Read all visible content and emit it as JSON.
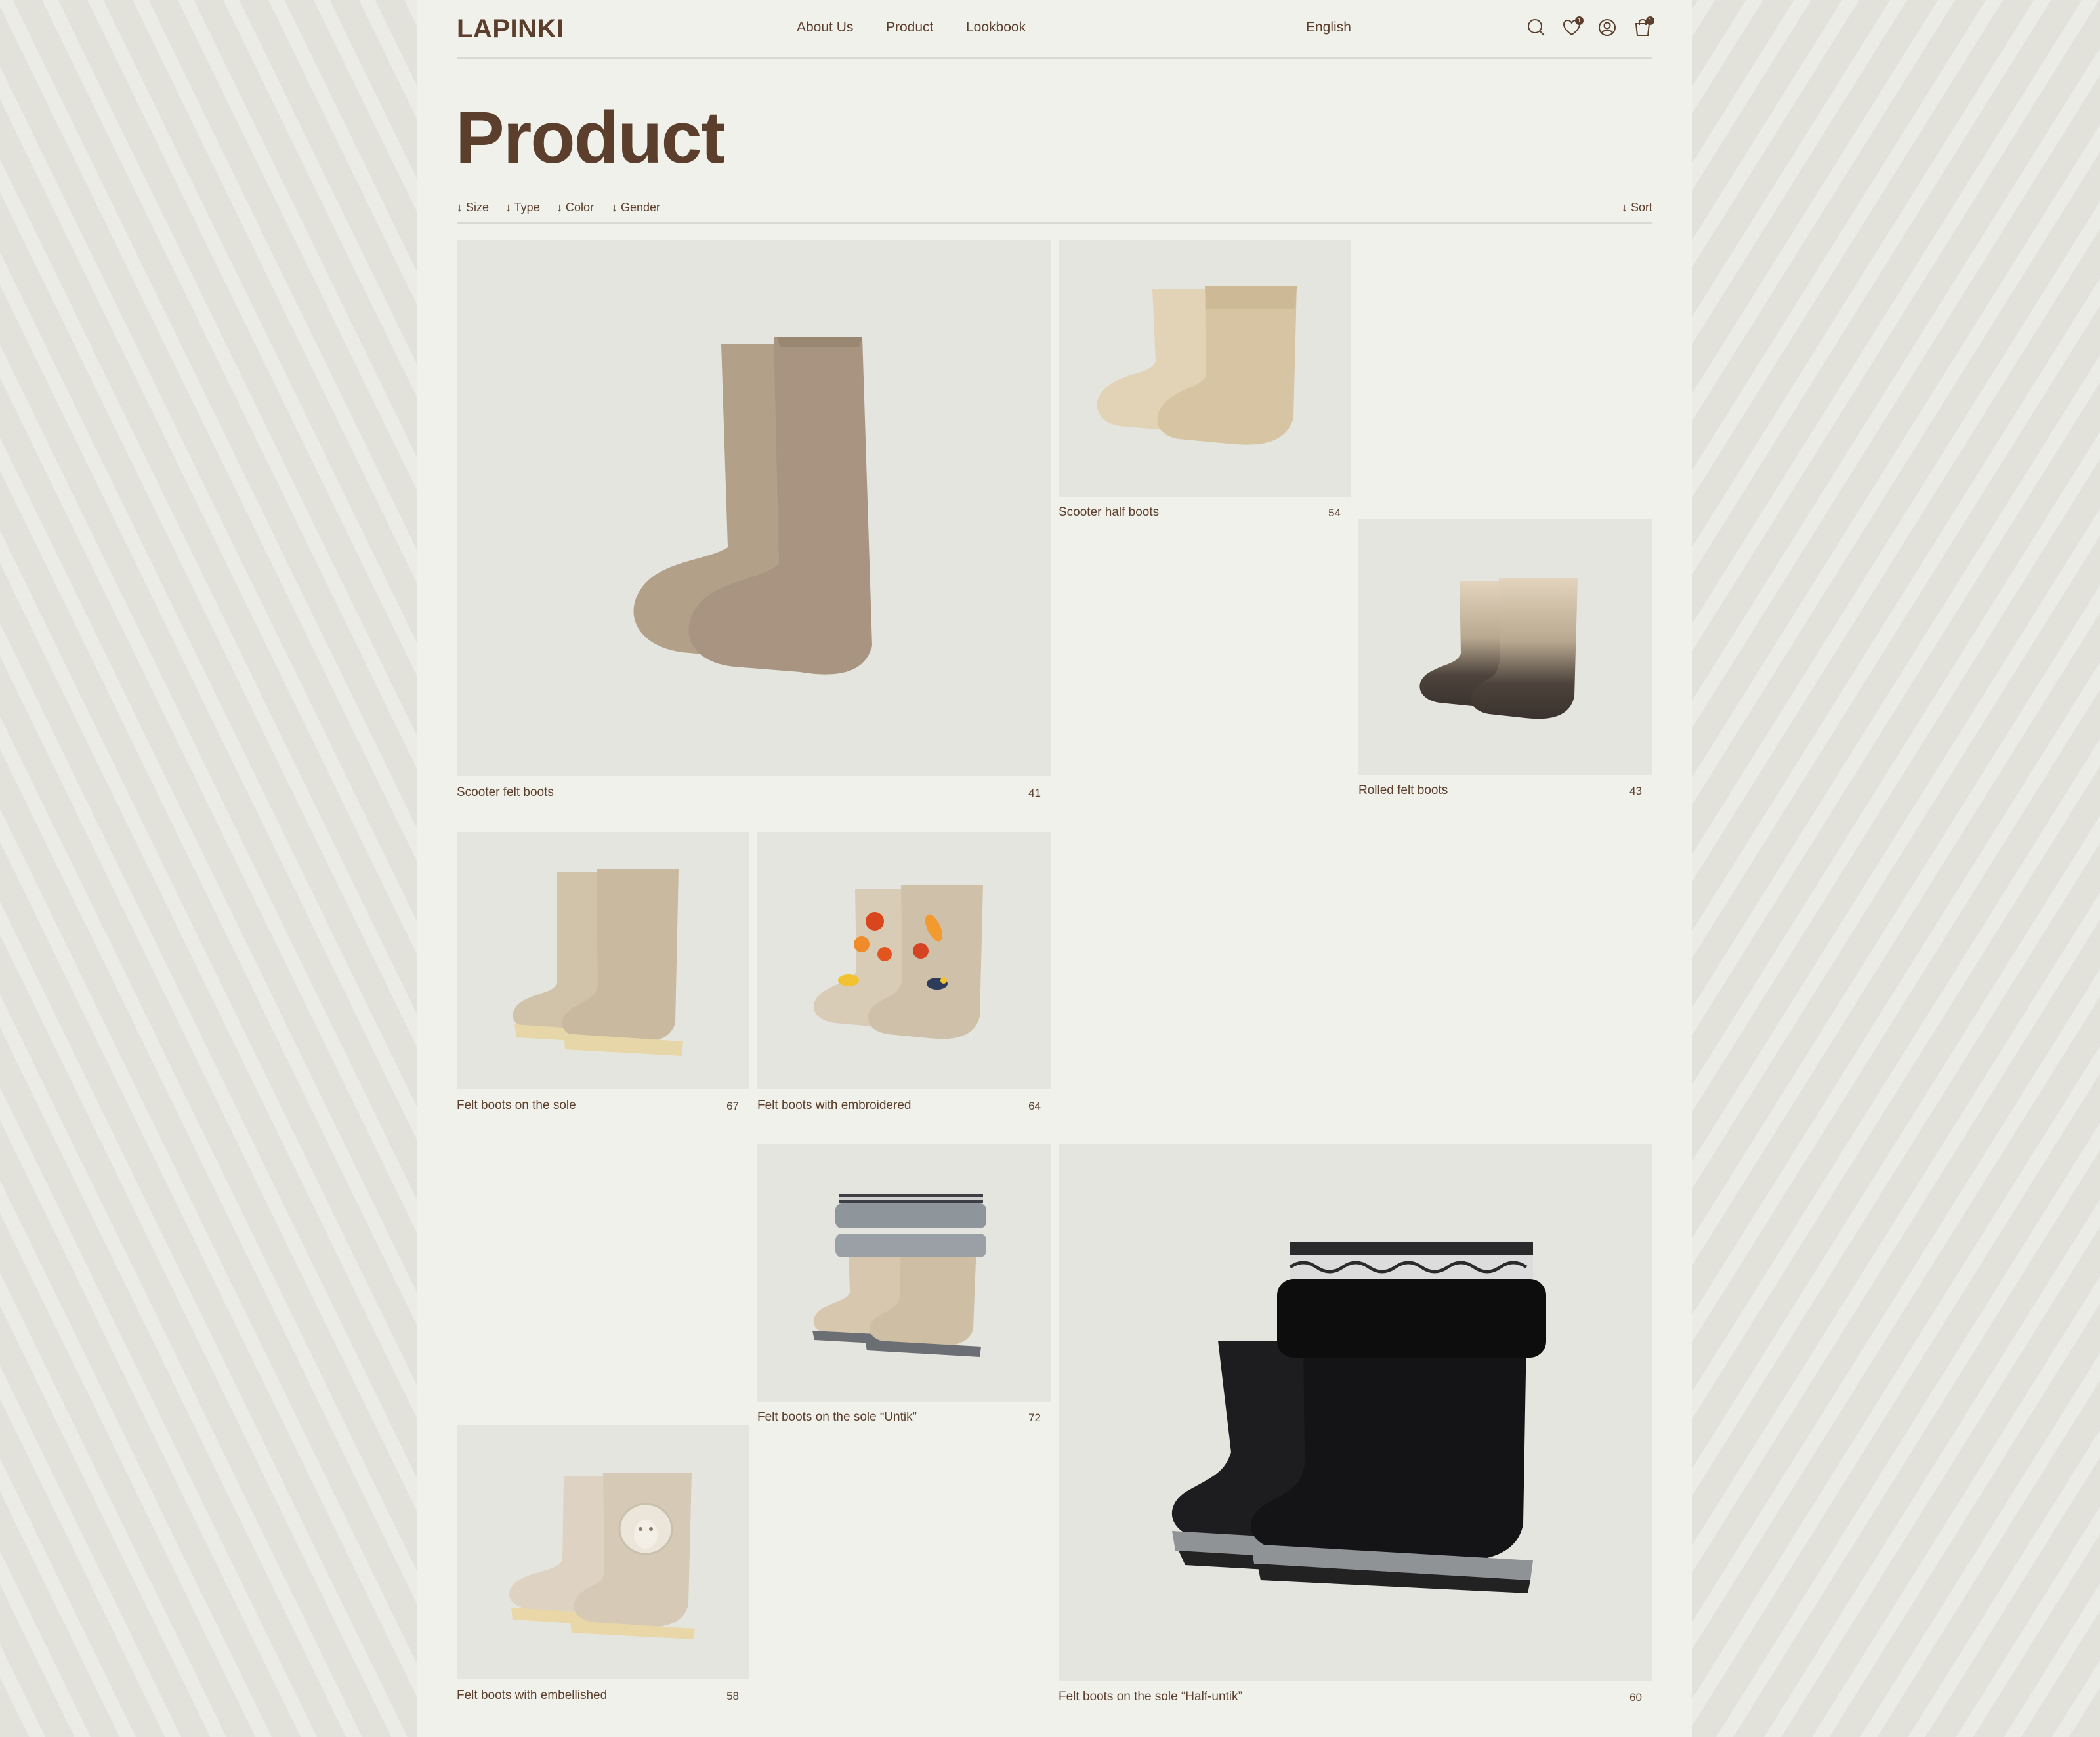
{
  "header": {
    "logo": "LAPINKI",
    "nav": [
      "About Us",
      "Product",
      "Lookbook"
    ],
    "language": "English",
    "wishlist_count": "1",
    "cart_count": "1"
  },
  "page_title": "Product",
  "filters": [
    "↓ Size",
    "↓ Type",
    "↓ Color",
    "↓ Gender"
  ],
  "sort_label": "↓ Sort",
  "colors": {
    "page_bg": "#f1f1ec",
    "tile_bg": "#e5e5df",
    "brand_brown": "#5b3f2c",
    "divider": "#d9d8d2"
  },
  "products": [
    {
      "name": "Scooter felt boots",
      "size": "41",
      "style": "tall-grey-brown"
    },
    {
      "name": "Scooter half boots",
      "size": "54",
      "style": "short-cream"
    },
    {
      "name": "Rolled felt boots",
      "size": "43",
      "style": "ombre-dark"
    },
    {
      "name": "Felt boots on the sole",
      "size": "67",
      "style": "tall-sole"
    },
    {
      "name": "Felt boots with embroidered",
      "size": "64",
      "style": "embroidered"
    },
    {
      "name": "Felt boots on the sole “Untik”",
      "size": "72",
      "style": "fur-grey"
    },
    {
      "name": "Felt boots with embellished",
      "size": "58",
      "style": "sheep"
    },
    {
      "name": "Felt boots on the sole “Half-untik”",
      "size": "60",
      "style": "black-fur"
    }
  ]
}
